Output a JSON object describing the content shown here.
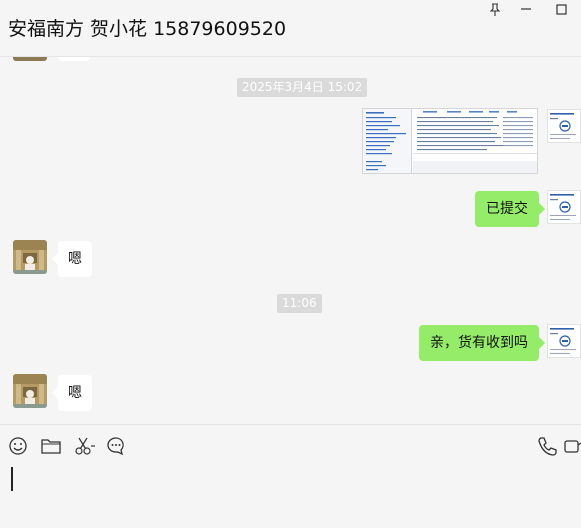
{
  "header": {
    "title": "安福南方 贺小花 15879609520"
  },
  "messages": {
    "time1": "2025年3月4日 15:02",
    "sent_submitted": "已提交",
    "recv_1": "嗯",
    "time2": "11:06",
    "sent_question": "亲，货有收到吗",
    "recv_2": "嗯"
  },
  "icons": [
    "pin-icon",
    "minimize-icon",
    "maximize-icon",
    "emoji-icon",
    "folder-icon",
    "scissors-icon",
    "chat-bubble-icon",
    "phone-icon",
    "video-icon"
  ],
  "colors": {
    "sent_bubble": "#95ec69",
    "recv_bubble": "#ffffff",
    "background": "#f5f5f5"
  }
}
